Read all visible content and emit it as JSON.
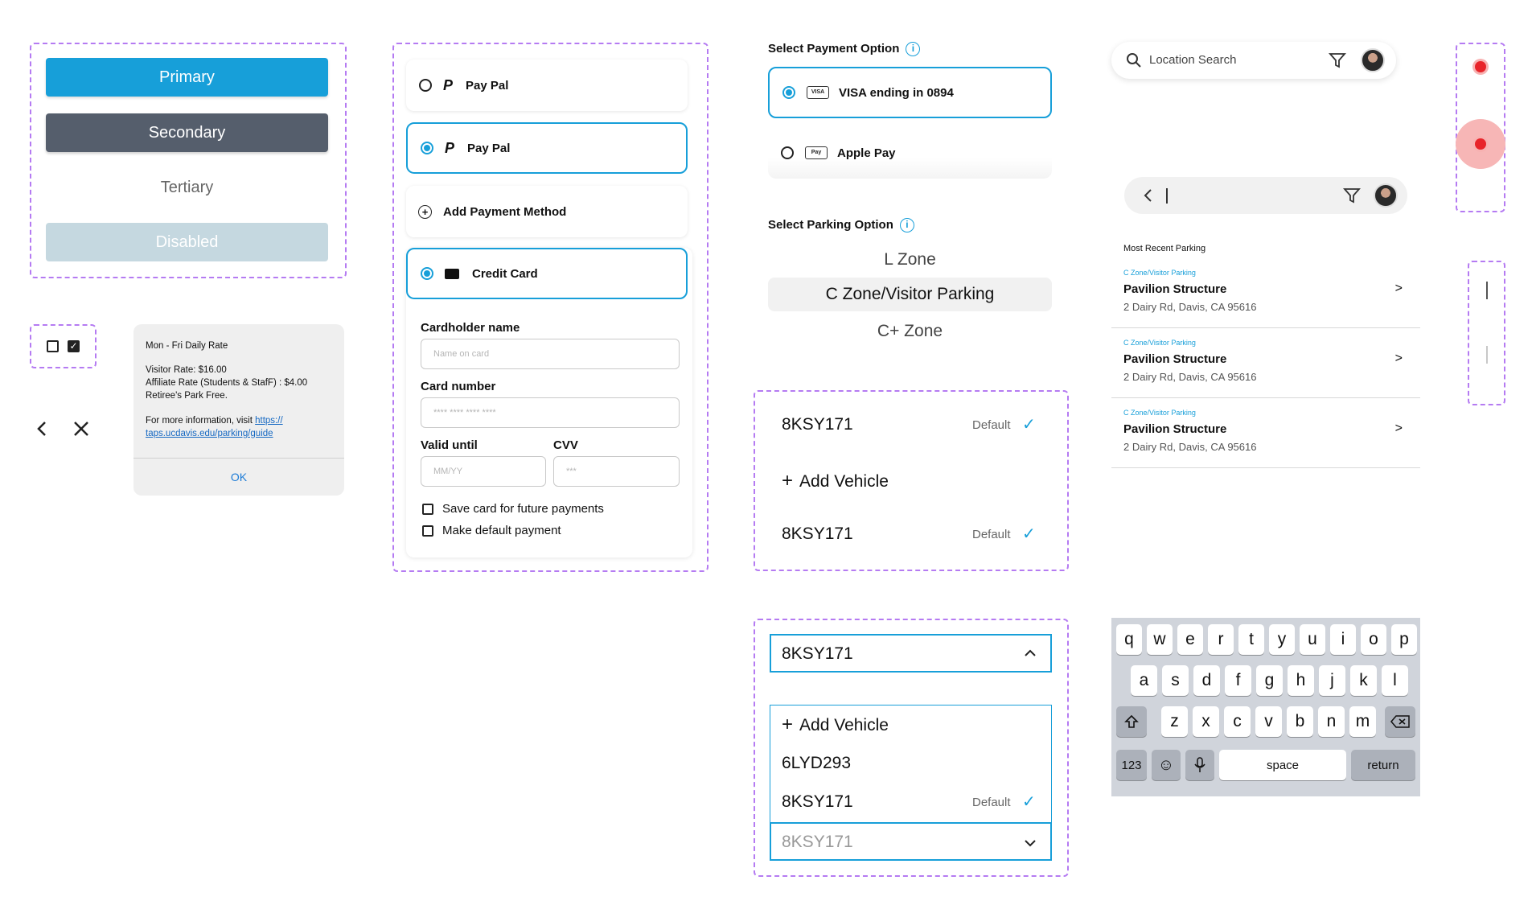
{
  "buttons": {
    "primary": "Primary",
    "secondary": "Secondary",
    "tertiary": "Tertiary",
    "disabled": "Disabled"
  },
  "dialog": {
    "heading": "Mon - Fri Daily Rate",
    "visitor": "Visitor Rate: $16.00",
    "affiliate": "Affiliate Rate (Students & StafF) : $4.00",
    "retiree": "Retiree's Park Free.",
    "more_prefix": "For more information, visit ",
    "link_part1": "https://",
    "link_part2": "taps.ucdavis.edu/parking/guide",
    "ok": "OK"
  },
  "payment": {
    "option1": "Pay Pal",
    "option2": "Pay Pal",
    "add": "Add Payment Method",
    "credit": "Credit Card",
    "cardholder_label": "Cardholder name",
    "cardholder_placeholder": "Name on card",
    "number_label": "Card number",
    "number_placeholder": "**** **** **** ****",
    "valid_label": "Valid until",
    "valid_placeholder": "MM/YY",
    "cvv_label": "CVV",
    "cvv_placeholder": "***",
    "save_card": "Save card for future payments",
    "make_default": "Make default payment"
  },
  "select_payment": {
    "title": "Select Payment Option",
    "visa_icon": "VISA",
    "visa": "VISA ending in 0894",
    "apple_icon": "Pay",
    "apple": "Apple Pay"
  },
  "select_parking": {
    "title": "Select Parking Option",
    "zones": [
      "L Zone",
      "C Zone/Visitor Parking",
      "C+ Zone"
    ]
  },
  "vehicles": {
    "v1": "8KSY171",
    "default_label": "Default",
    "add": "Add Vehicle",
    "v2": "8KSY171"
  },
  "dropdown": {
    "selected": "8KSY171",
    "add": "Add Vehicle",
    "items": [
      "6LYD293",
      "8KSY171"
    ],
    "default_label": "Default",
    "collapsed": "8KSY171"
  },
  "search": {
    "placeholder": "Location Search"
  },
  "recent": {
    "title": "Most Recent Parking",
    "items": [
      {
        "tag": "C Zone/Visitor Parking",
        "name": "Pavilion Structure",
        "address": "2 Dairy Rd, Davis, CA 95616"
      },
      {
        "tag": "C Zone/Visitor Parking",
        "name": "Pavilion Structure",
        "address": "2 Dairy Rd, Davis, CA 95616"
      },
      {
        "tag": "C Zone/Visitor Parking",
        "name": "Pavilion Structure",
        "address": "2 Dairy Rd, Davis, CA 95616"
      }
    ]
  },
  "keyboard": {
    "row1": [
      "q",
      "w",
      "e",
      "r",
      "t",
      "y",
      "u",
      "i",
      "o",
      "p"
    ],
    "row2": [
      "a",
      "s",
      "d",
      "f",
      "g",
      "h",
      "j",
      "k",
      "l"
    ],
    "row3": [
      "z",
      "x",
      "c",
      "v",
      "b",
      "n",
      "m"
    ],
    "num": "123",
    "space": "space",
    "return": "return"
  },
  "colors": {
    "accent": "#179fd9",
    "dashed": "#b57bf2",
    "secondary": "#555e6c",
    "disabled": "#c5d8e0",
    "marker": "#e8242a"
  }
}
